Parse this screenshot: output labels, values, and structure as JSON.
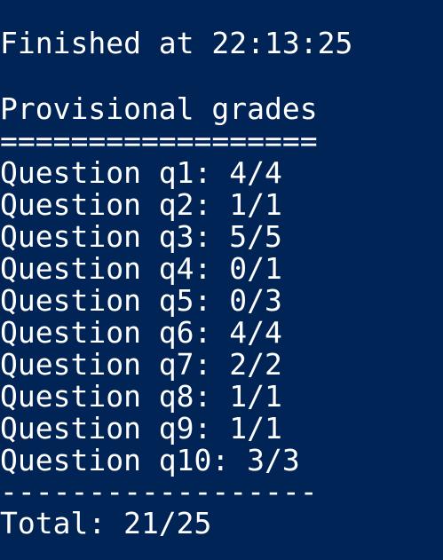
{
  "terminal": {
    "background_color": "#012456",
    "text_color": "#ffffff",
    "finished_line": "Finished at 22:13:25",
    "heading": "Provisional grades",
    "rule_top": "==================",
    "questions": [
      "Question q1: 4/4",
      "Question q2: 1/1",
      "Question q3: 5/5",
      "Question q4: 0/1",
      "Question q5: 0/3",
      "Question q6: 4/4",
      "Question q7: 2/2",
      "Question q8: 1/1",
      "Question q9: 1/1",
      "Question q10: 3/3"
    ],
    "rule_bottom": "------------------",
    "total_line": "Total: 21/25"
  }
}
